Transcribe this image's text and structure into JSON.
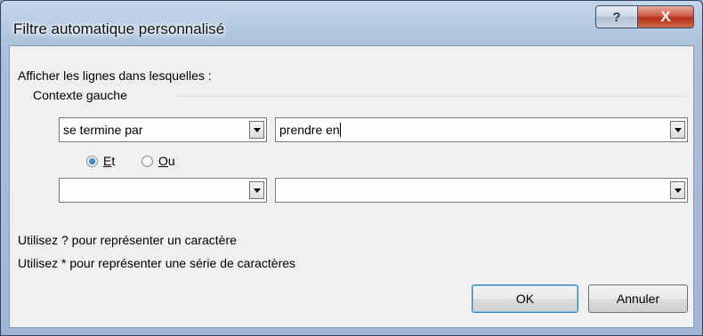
{
  "window": {
    "title": "Filtre automatique personnalisé",
    "help_glyph": "?",
    "close_glyph": "X"
  },
  "dialog": {
    "prompt": "Afficher les lignes dans lesquelles :",
    "group_label": "Contexte gauche",
    "condition1": {
      "operator": "se termine par",
      "value": "prendre en"
    },
    "logic": {
      "and": {
        "prefix": "",
        "mnemonic": "E",
        "rest": "t",
        "selected": true
      },
      "or": {
        "prefix": "",
        "mnemonic": "O",
        "rest": "u",
        "selected": false
      }
    },
    "condition2": {
      "operator": "",
      "value": ""
    },
    "hint1": "Utilisez ? pour représenter un caractère",
    "hint2": "Utilisez * pour représenter une série de caractères",
    "ok_label": "OK",
    "cancel_label": "Annuler"
  }
}
